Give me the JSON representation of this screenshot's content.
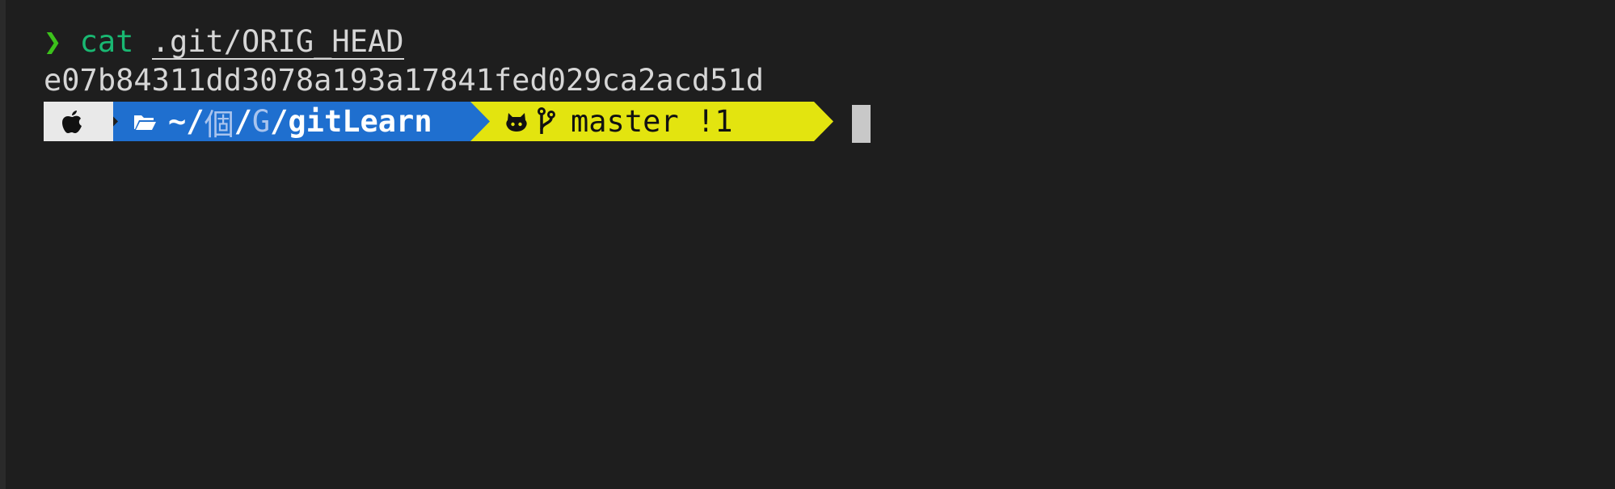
{
  "terminal": {
    "command_line": {
      "prompt_symbol": "❯",
      "command": "cat",
      "argument": ".git/ORIG_HEAD"
    },
    "output": "e07b84311dd3078a193a17841fed029ca2acd51d",
    "powerline": {
      "os_icon": "apple-icon",
      "dir": {
        "icon": "folder-open-icon",
        "prefix": "~/",
        "part1": "個",
        "sep": "/",
        "part2": "G",
        "sep2": "/",
        "current": "gitLearn"
      },
      "git": {
        "icon_github": "github-icon",
        "icon_branch": "git-branch-icon",
        "branch": "master",
        "status": "!1"
      }
    },
    "colors": {
      "background": "#1e1e1e",
      "prompt": "#3cc21b",
      "command": "#19b872",
      "dir_segment": "#1f6fcf",
      "git_segment": "#e3e40f",
      "os_segment": "#e9e9e9"
    }
  }
}
